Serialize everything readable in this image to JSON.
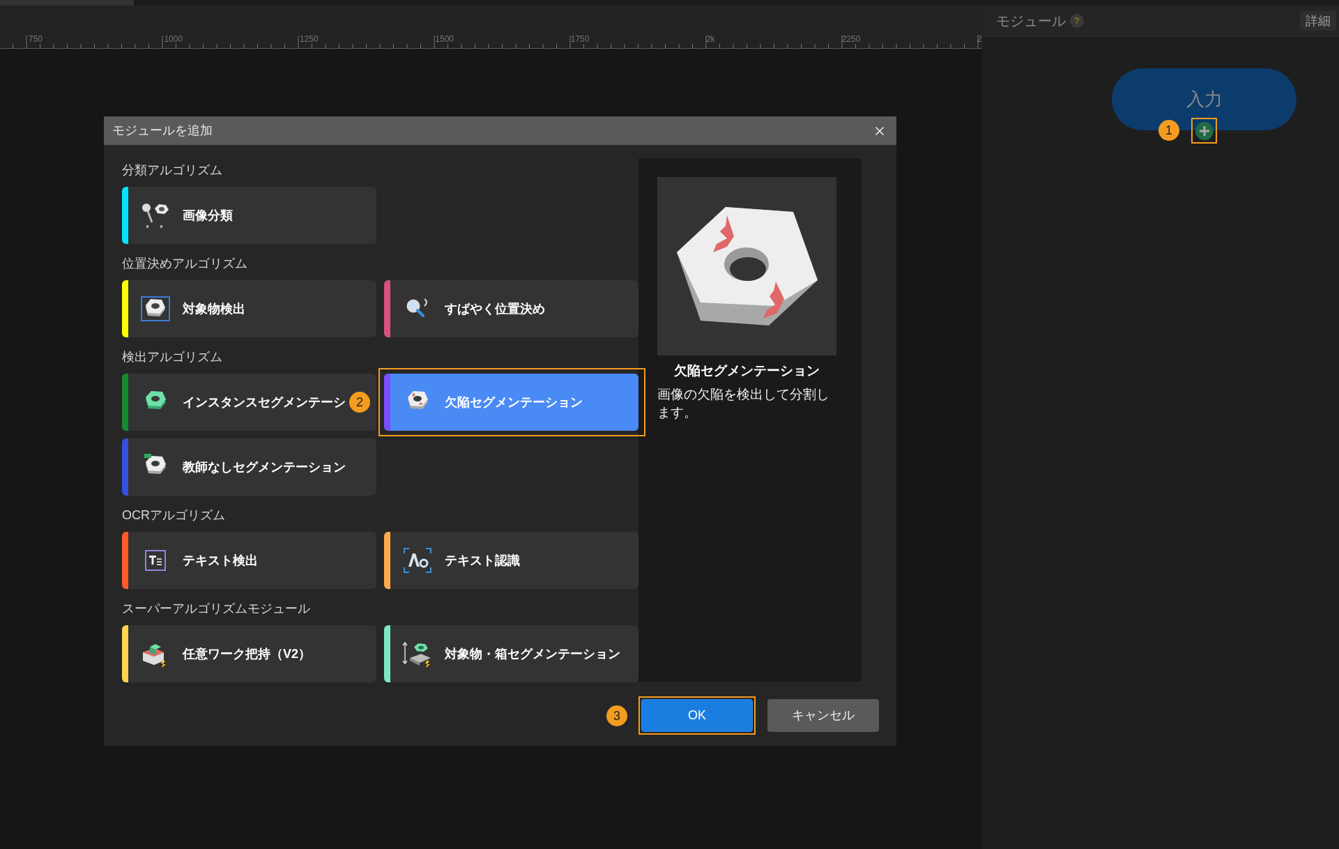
{
  "ruler": {
    "labels": [
      "750",
      "1000",
      "1250",
      "1500",
      "1750",
      "2k",
      "2250",
      "2"
    ]
  },
  "modules_panel": {
    "title": "モジュール",
    "help": "?",
    "details_button": "詳細",
    "node": {
      "label": "入力"
    },
    "add_button": {
      "highlighted": true,
      "badge": "1"
    }
  },
  "dialog": {
    "title": "モジュールを追加",
    "categories": [
      {
        "title": "分類アルゴリズム",
        "items": [
          {
            "label": "画像分類",
            "color": "#00e5ff",
            "selected": false,
            "highlighted": false
          }
        ]
      },
      {
        "title": "位置決めアルゴリズム",
        "items": [
          {
            "label": "対象物検出",
            "color": "#ffff00",
            "selected": false,
            "highlighted": false
          },
          {
            "label": "すばやく位置決め",
            "color": "#d9527f",
            "selected": false,
            "highlighted": false
          }
        ]
      },
      {
        "title": "検出アルゴリズム",
        "items": [
          {
            "label": "インスタンスセグメンテーシ",
            "color": "#168a2f",
            "selected": false,
            "highlighted": false
          },
          {
            "label": "欠陥セグメンテーション",
            "color": "#7a4dff",
            "selected": true,
            "highlighted": true,
            "badge": "2"
          },
          {
            "label": "教師なしセグメンテーション",
            "color": "#3551e0",
            "selected": false,
            "highlighted": false
          }
        ]
      },
      {
        "title": "OCRアルゴリズム",
        "items": [
          {
            "label": "テキスト検出",
            "color": "#ff5a28",
            "selected": false,
            "highlighted": false
          },
          {
            "label": "テキスト認識",
            "color": "#ffa94d",
            "selected": false,
            "highlighted": false
          }
        ]
      },
      {
        "title": "スーパーアルゴリズムモジュール",
        "items": [
          {
            "label": "任意ワーク把持（V2）",
            "color": "#ffd54f",
            "selected": false,
            "highlighted": false
          },
          {
            "label": "対象物・箱セグメンテーション",
            "color": "#7ee8c4",
            "selected": false,
            "highlighted": false
          }
        ]
      }
    ],
    "preview": {
      "title": "欠陥セグメンテーション",
      "description": "画像の欠陥を検出して分割します。"
    },
    "buttons": [
      {
        "label": "OK",
        "kind": "primary",
        "highlighted": true,
        "badge": "3"
      },
      {
        "label": "キャンセル",
        "kind": "secondary",
        "highlighted": false
      }
    ]
  }
}
